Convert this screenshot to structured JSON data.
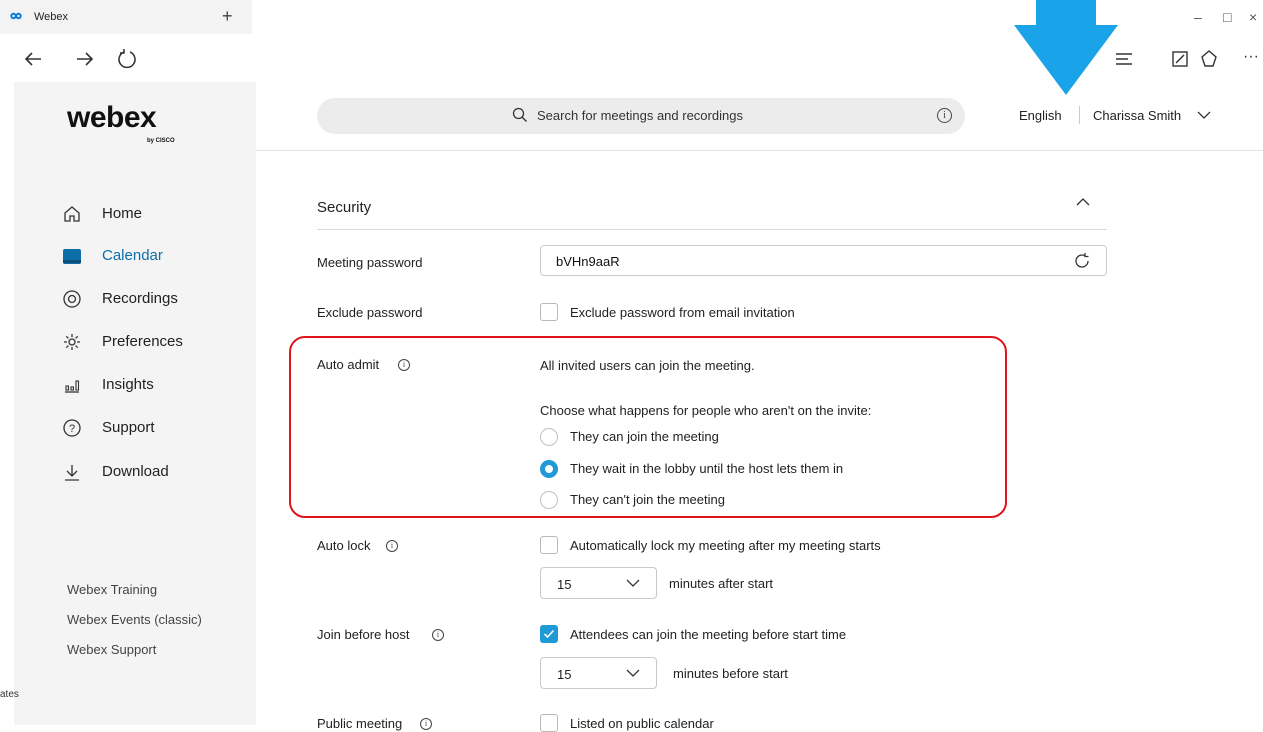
{
  "browser": {
    "tab_title": "Webex",
    "new_tab": "+",
    "window_controls": [
      "–",
      "□",
      "×"
    ],
    "icons": [
      "back-icon",
      "forward-icon",
      "refresh-icon",
      "reading-list-icon",
      "notes-icon",
      "share-icon",
      "more-icon"
    ]
  },
  "sidebar": {
    "logo": "webex",
    "logo_sub": "by CISCO",
    "items": [
      {
        "label": "Home",
        "icon": "home-icon"
      },
      {
        "label": "Calendar",
        "icon": "calendar-icon",
        "active": true
      },
      {
        "label": "Recordings",
        "icon": "recordings-icon"
      },
      {
        "label": "Preferences",
        "icon": "gear-icon"
      },
      {
        "label": "Insights",
        "icon": "insights-icon"
      },
      {
        "label": "Support",
        "icon": "help-icon"
      },
      {
        "label": "Download",
        "icon": "download-icon"
      }
    ],
    "footer_links": [
      "Webex Training",
      "Webex Events (classic)",
      "Webex Support"
    ],
    "edge_text": "ates"
  },
  "header": {
    "search_placeholder": "Search for meetings and recordings",
    "language": "English",
    "user": "Charissa Smith"
  },
  "security": {
    "title": "Security",
    "meeting_password": {
      "label": "Meeting password",
      "value": "bVHn9aaR"
    },
    "exclude_password": {
      "label": "Exclude password",
      "checkbox_label": "Exclude password from email invitation",
      "checked": false
    },
    "auto_admit": {
      "label": "Auto admit",
      "description": "All invited users can join the meeting.",
      "question": "Choose what happens for people who aren't on the invite:",
      "options": [
        {
          "label": "They can join the meeting",
          "selected": false
        },
        {
          "label": "They wait in the lobby until the host lets them in",
          "selected": true
        },
        {
          "label": "They can't join the meeting",
          "selected": false
        }
      ]
    },
    "auto_lock": {
      "label": "Auto lock",
      "checkbox_label": "Automatically lock my meeting after my meeting starts",
      "checked": false,
      "minutes": "15",
      "suffix": "minutes after start"
    },
    "join_before_host": {
      "label": "Join before host",
      "checkbox_label": "Attendees can join the meeting before start time",
      "checked": true,
      "minutes": "15",
      "suffix": "minutes before start"
    },
    "public_meeting": {
      "label": "Public meeting",
      "checkbox_label": "Listed on public calendar",
      "checked": false
    }
  },
  "colors": {
    "accent": "#1f9ad6",
    "active_nav": "#0e6ea8",
    "highlight": "#e0131b",
    "arrow": "#1aa3e8"
  }
}
